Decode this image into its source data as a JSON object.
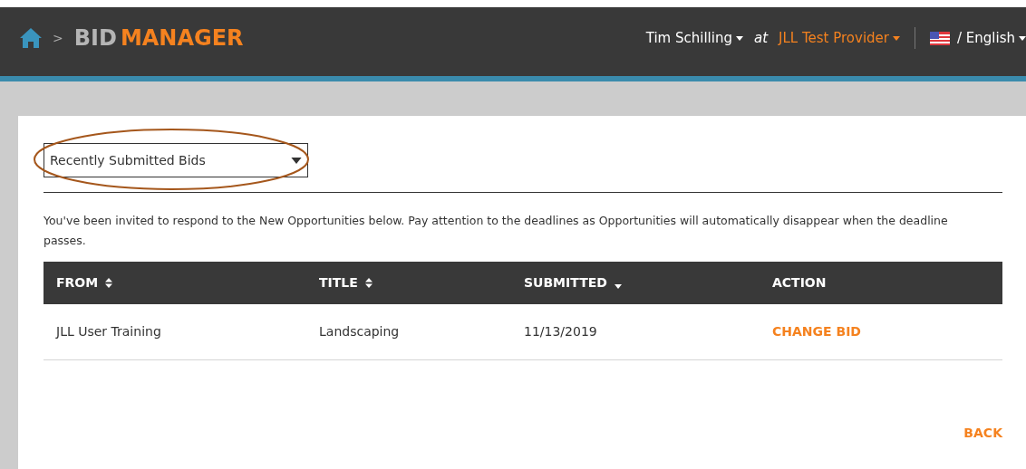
{
  "header": {
    "separator": ">",
    "title_prefix": "BID",
    "title_main": "MANAGER",
    "user": "Tim Schilling",
    "at": "at",
    "provider": "JLL Test Provider",
    "language": "/ English"
  },
  "filter": {
    "value": "Recently Submitted Bids",
    "highlighted": true
  },
  "intro": "You've been invited to respond to the New Opportunities below. Pay attention to the deadlines as Opportunities will automatically disappear when the deadline passes.",
  "table": {
    "columns": [
      {
        "label": "FROM",
        "sortable": true,
        "sorted": false
      },
      {
        "label": "TITLE",
        "sortable": true,
        "sorted": false
      },
      {
        "label": "SUBMITTED",
        "sortable": true,
        "sorted": true
      },
      {
        "label": "ACTION",
        "sortable": false
      }
    ],
    "rows": [
      {
        "from": "JLL User Training",
        "title": "Landscaping",
        "submitted": "11/13/2019",
        "action": "CHANGE BID"
      }
    ]
  },
  "back": "BACK"
}
